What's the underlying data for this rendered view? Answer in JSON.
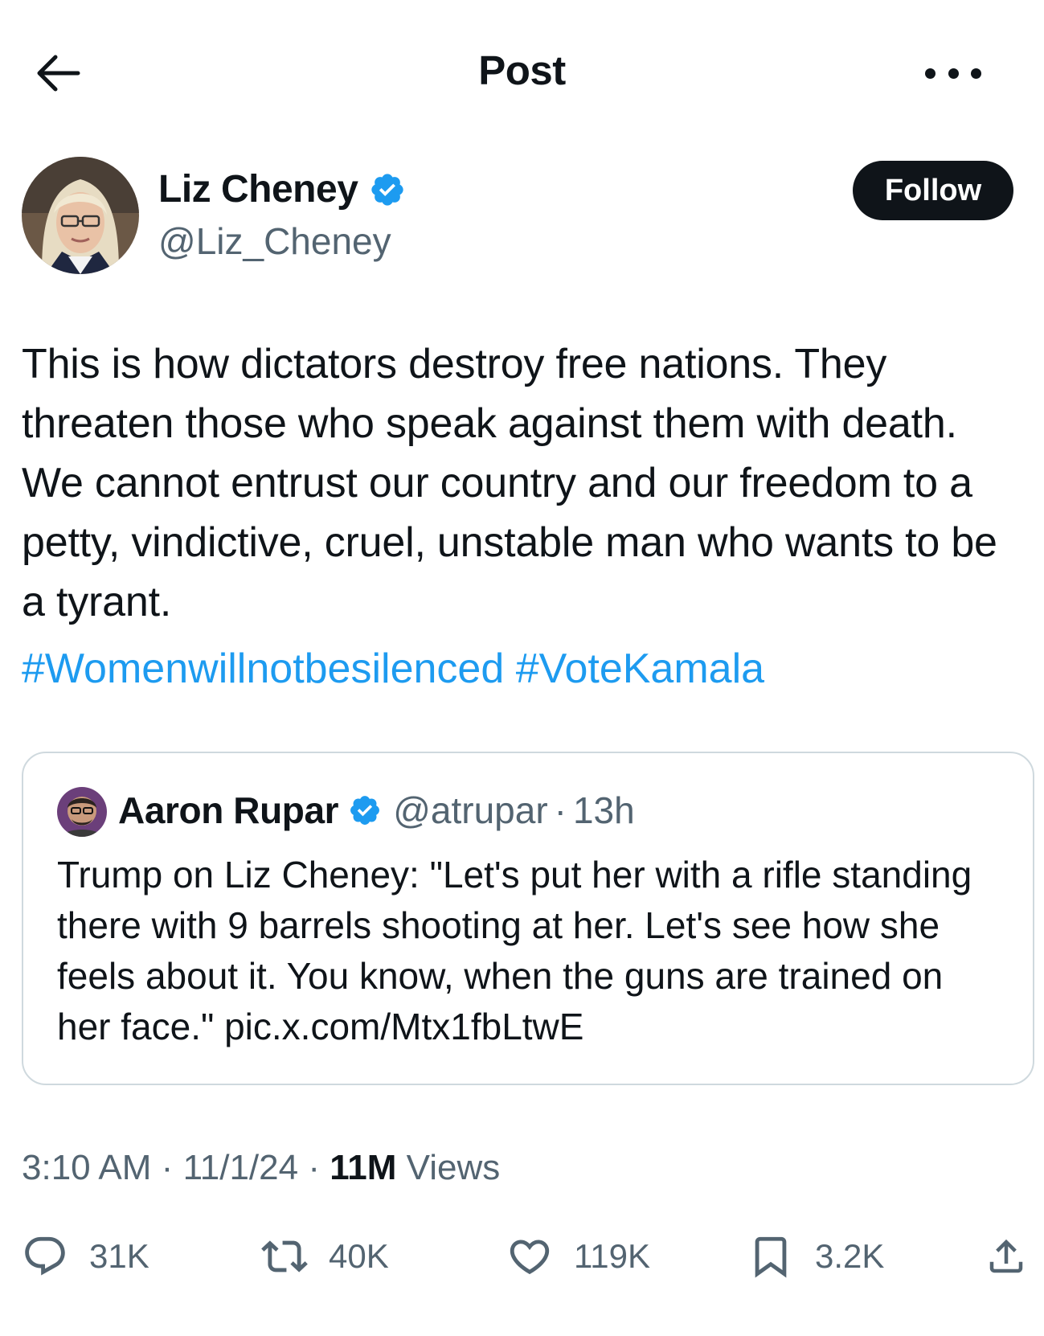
{
  "header": {
    "title": "Post"
  },
  "author": {
    "name": "Liz Cheney",
    "handle": "@Liz_Cheney",
    "follow_label": "Follow"
  },
  "tweet": {
    "text": "This is how dictators destroy free nations. They threaten those who speak against them with death. We cannot entrust our country and our freedom to a petty, vindictive, cruel, unstable man who wants to be a tyrant.",
    "hashtags": [
      "#Womenwillnotbesilenced",
      "#VoteKamala"
    ]
  },
  "quote": {
    "name": "Aaron Rupar",
    "handle": "@atrupar",
    "separator": "·",
    "time": "13h",
    "text": "Trump on Liz Cheney: \"Let's put her with a rifle standing there with 9 barrels shooting at her. Let's see how she feels about it. You know, when the guns are trained on her face.\" pic.x.com/Mtx1fbLtwE"
  },
  "meta": {
    "time": "3:10 AM",
    "separator": "·",
    "date": "11/1/24",
    "views_count": "11M",
    "views_label": "Views"
  },
  "actions": {
    "replies": "31K",
    "reposts": "40K",
    "likes": "119K",
    "bookmarks": "3.2K"
  },
  "colors": {
    "accent": "#1d9bf0",
    "text": "#0f1419",
    "secondary": "#536471",
    "border": "#cfd9de"
  },
  "icons": [
    "back-arrow-icon",
    "more-icon",
    "verified-badge-icon",
    "reply-icon",
    "repost-icon",
    "like-icon",
    "bookmark-icon",
    "share-icon"
  ]
}
